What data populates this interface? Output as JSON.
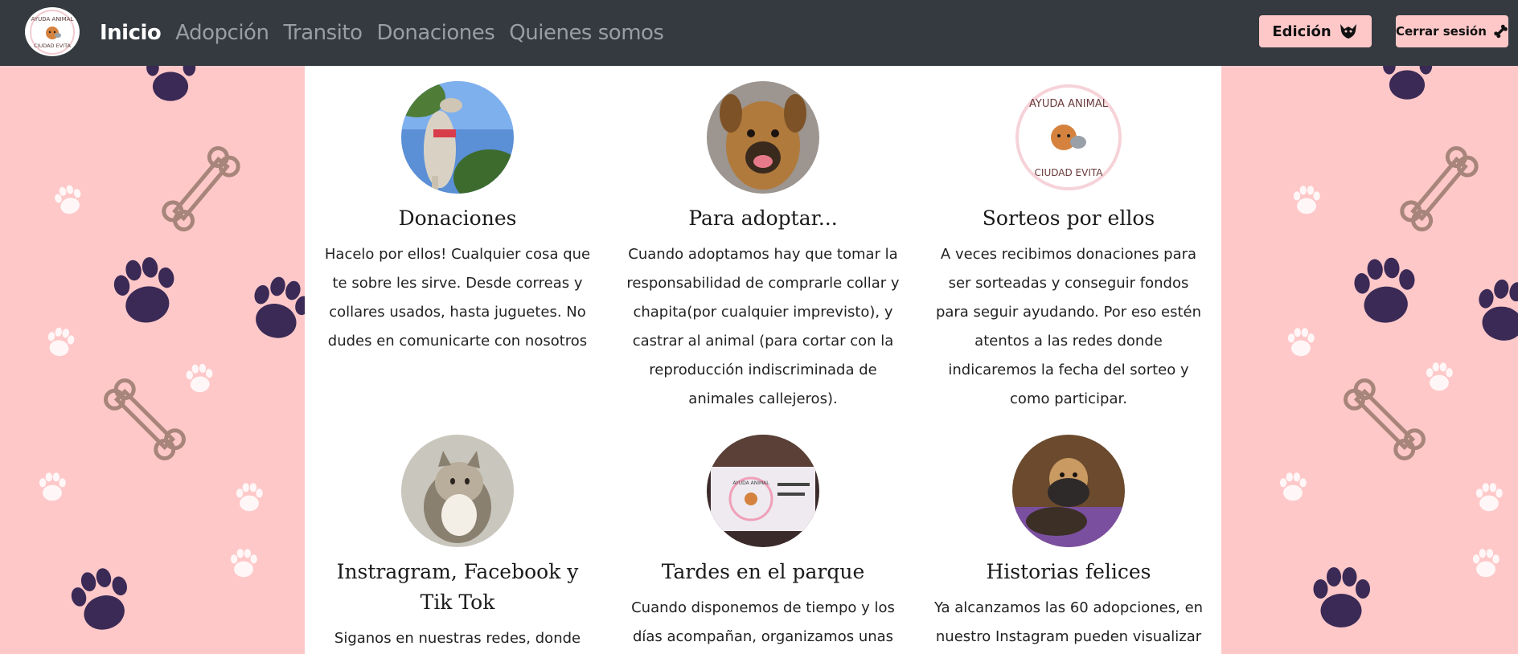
{
  "nav": {
    "logo_alt": "Ayuda Animal Ciudad Evita",
    "links": [
      "Inicio",
      "Adopción",
      "Transito",
      "Donaciones",
      "Quienes somos"
    ],
    "edicion_label": "Edición",
    "logout_label": "Cerrar sesión"
  },
  "colors": {
    "navbar": "#343a40",
    "background": "#fec8c9",
    "button": "#fec8c9",
    "paw": "#3a2a55",
    "bone": "#a8857a"
  },
  "cards": [
    {
      "title": "Donaciones",
      "text": "Hacelo por ellos! Cualquier cosa que te sobre les sirve. Desde correas y collares usados, hasta juguetes. No dudes en comunicarte con nosotros",
      "image": "greyhound-dog-photo"
    },
    {
      "title": "Para adoptar...",
      "text": "Cuando adoptamos hay que tomar la responsabilidad de comprarle collar y chapita(por cualquier imprevisto), y castrar al animal (para cortar con la reproducción indiscriminada de animales callejeros).",
      "image": "brown-dog-photo"
    },
    {
      "title": "Sorteos por ellos",
      "text": "A veces recibimos donaciones para ser sorteadas y conseguir fondos para seguir ayudando. Por eso estén atentos a las redes donde indicaremos la fecha del sorteo y como participar.",
      "image": "ayuda-animal-logo"
    },
    {
      "title": "Instragram, Facebook y Tik Tok",
      "text": "Siganos en nuestras redes, donde",
      "image": "tabby-cat-photo"
    },
    {
      "title": "Tardes en el parque",
      "text": "Cuando disponemos de tiempo y los días acompañan, organizamos unas hermosas",
      "image": "park-banner-photo"
    },
    {
      "title": "Historias felices",
      "text": "Ya alcanzamos las 60 adopciones, en nuestro Instagram pueden visualizar",
      "image": "puppies-photo"
    }
  ]
}
